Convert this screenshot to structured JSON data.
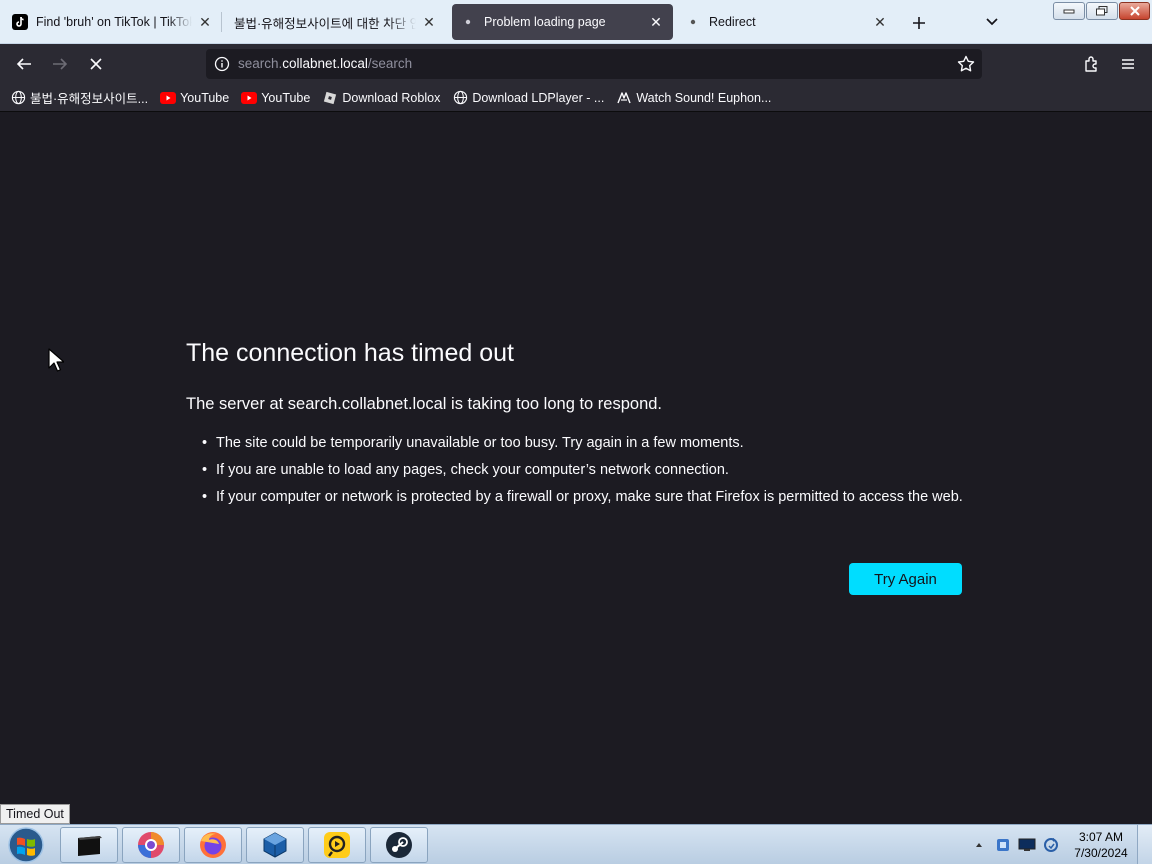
{
  "tabs": [
    {
      "label": "Find 'bruh' on TikTok | TikTok Search",
      "favicon": "tiktok-icon",
      "active": false
    },
    {
      "label": "불법·유해정보사이트에 대한 차단 안내",
      "favicon": "none",
      "active": false
    },
    {
      "label": "Problem loading page",
      "favicon": "page-icon",
      "active": true
    },
    {
      "label": "Redirect",
      "favicon": "page-icon",
      "active": false
    }
  ],
  "navbar": {
    "url_scheme_host_prefix": "search.",
    "url_host": "collabnet.local",
    "url_path": "/search"
  },
  "bookmarks": [
    {
      "label": "불법·유해정보사이트...",
      "icon": "globe-icon"
    },
    {
      "label": "YouTube",
      "icon": "youtube-icon"
    },
    {
      "label": "YouTube",
      "icon": "youtube-icon"
    },
    {
      "label": "Download Roblox",
      "icon": "roblox-icon"
    },
    {
      "label": "Download LDPlayer - ...",
      "icon": "globe-icon"
    },
    {
      "label": "Watch Sound! Euphon...",
      "icon": "anime-icon"
    }
  ],
  "error": {
    "title": "The connection has timed out",
    "description": "The server at search.collabnet.local is taking too long to respond.",
    "items": [
      "The site could be temporarily unavailable or too busy. Try again in a few moments.",
      "If you are unable to load any pages, check your computer’s network connection.",
      "If your computer or network is protected by a firewall or proxy, make sure that Firefox is permitted to access the web."
    ],
    "button_label": "Try Again"
  },
  "status_text": "Timed Out",
  "taskbar": {
    "apps": [
      "terminal-icon",
      "chrome-like-icon",
      "firefox-icon",
      "virtualbox-icon",
      "ldplayer-icon",
      "steam-icon"
    ],
    "time": "3:07 AM",
    "date": "7/30/2024"
  },
  "colors": {
    "accent_button": "#00ddff",
    "page_bg": "#1c1b22",
    "toolbar_bg": "#2b2a33"
  }
}
